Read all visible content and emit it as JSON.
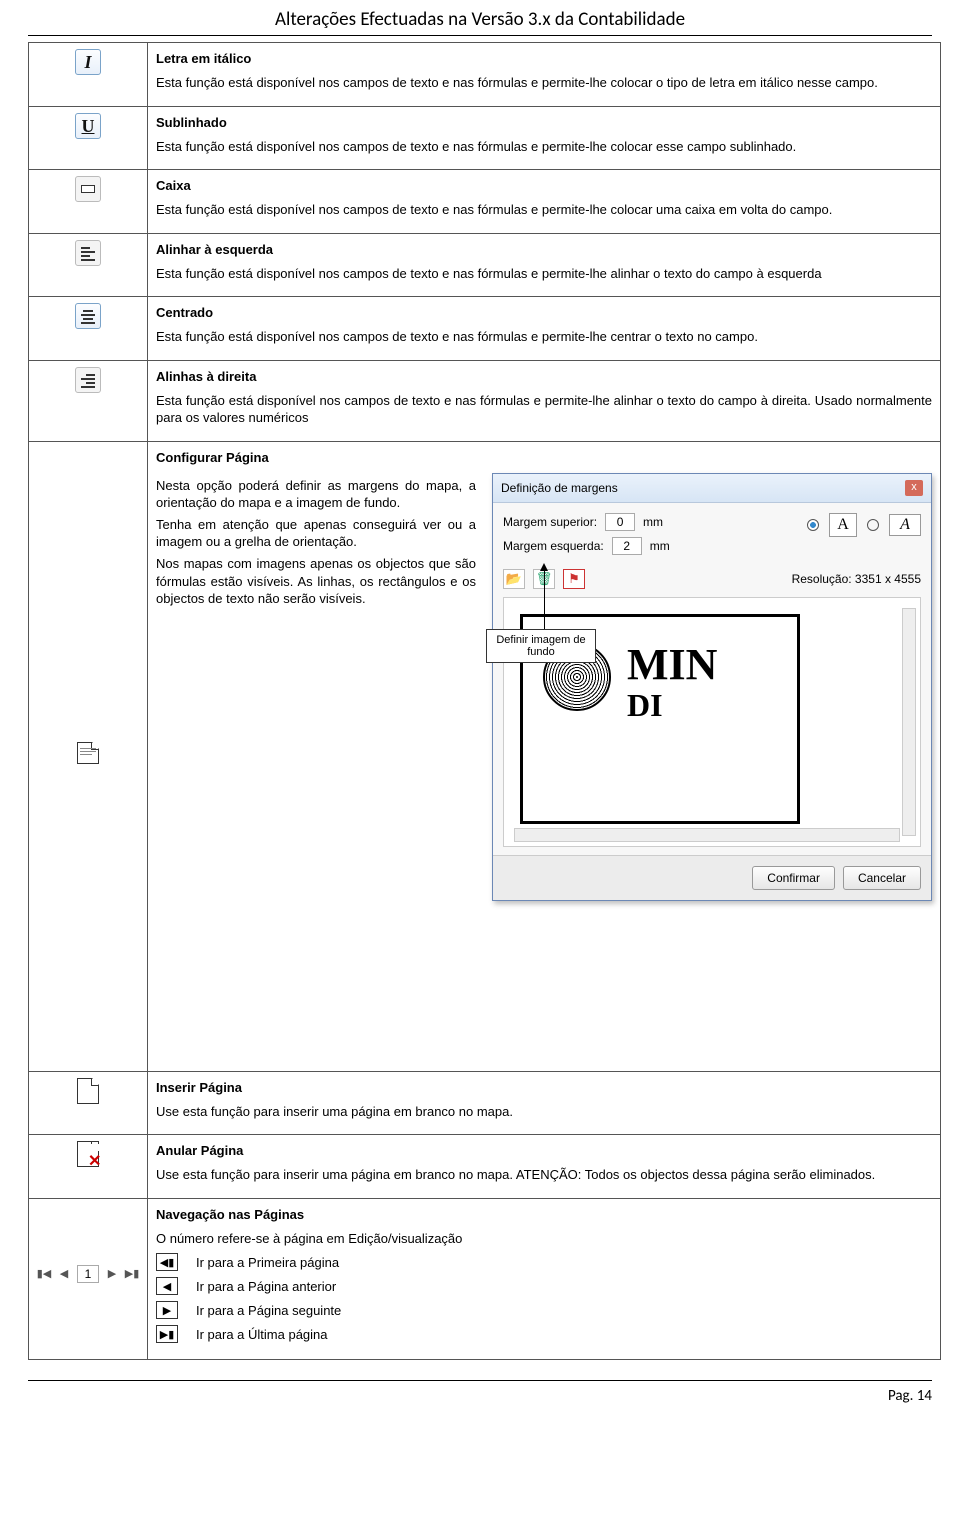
{
  "header": "Alterações Efectuadas na Versão 3.x da Contabilidade",
  "rows": {
    "italic": {
      "title": "Letra em itálico",
      "desc": "Esta função está disponível nos campos de texto e nas fórmulas e permite-lhe colocar o tipo de letra em itálico nesse campo."
    },
    "underline": {
      "title": "Sublinhado",
      "desc": "Esta função está disponível nos campos de texto e nas fórmulas e permite-lhe colocar esse campo sublinhado."
    },
    "box": {
      "title": "Caixa",
      "desc": "Esta função está disponível nos campos de texto e nas fórmulas e permite-lhe colocar uma caixa em volta do campo."
    },
    "alignleft": {
      "title": "Alinhar à esquerda",
      "desc": "Esta função está disponível nos campos de texto e nas fórmulas e permite-lhe alinhar o texto do campo à esquerda"
    },
    "center": {
      "title": "Centrado",
      "desc": "Esta função está disponível nos campos de texto e nas fórmulas e permite-lhe centrar o texto no campo."
    },
    "alignright": {
      "title": "Alinhas à direita",
      "desc": "Esta função está disponível nos campos de texto e nas fórmulas e permite-lhe alinhar o texto do campo à direita. Usado normalmente para os valores numéricos"
    },
    "pagesetup": {
      "title": "Configurar Página",
      "p1": "Nesta opção poderá definir as margens do mapa, a orientação do mapa e a imagem de fundo.",
      "p2": "Tenha em atenção que apenas conseguirá ver ou a imagem ou a grelha de orientação.",
      "p3": "Nos mapas com imagens apenas os objectos que são fórmulas estão visíveis. As linhas, os rectângulos e os objectos de texto não serão visíveis."
    },
    "insert": {
      "title": "Inserir Página",
      "desc": "Use esta função para inserir uma página em branco no mapa."
    },
    "annul": {
      "title": "Anular Página",
      "desc": "Use esta função para inserir uma página em branco no mapa. ATENÇÃO: Todos os objectos dessa página serão eliminados."
    },
    "nav": {
      "title": "Navegação nas Páginas",
      "desc": "O número refere-se à página em Edição/visualização",
      "first": "Ir para a Primeira página",
      "prev": "Ir para a Página anterior",
      "next": "Ir para a Página seguinte",
      "last": "Ir para a Última página",
      "pageno": "1"
    }
  },
  "dialog": {
    "title": "Definição de margens",
    "lbl_top": "Margem superior:",
    "lbl_left": "Margem esquerda:",
    "val_top": "0",
    "val_left": "2",
    "mm": "mm",
    "orient_a": "A",
    "res_label": "Resolução: 3351 x 4555",
    "confirm": "Confirmar",
    "cancel": "Cancelar",
    "big1": "MIN",
    "big2": "DI",
    "callout": "Definir imagem de fundo",
    "close": "x"
  },
  "icons": {
    "I": "I",
    "U": "U"
  },
  "footer": "Pag. 14"
}
